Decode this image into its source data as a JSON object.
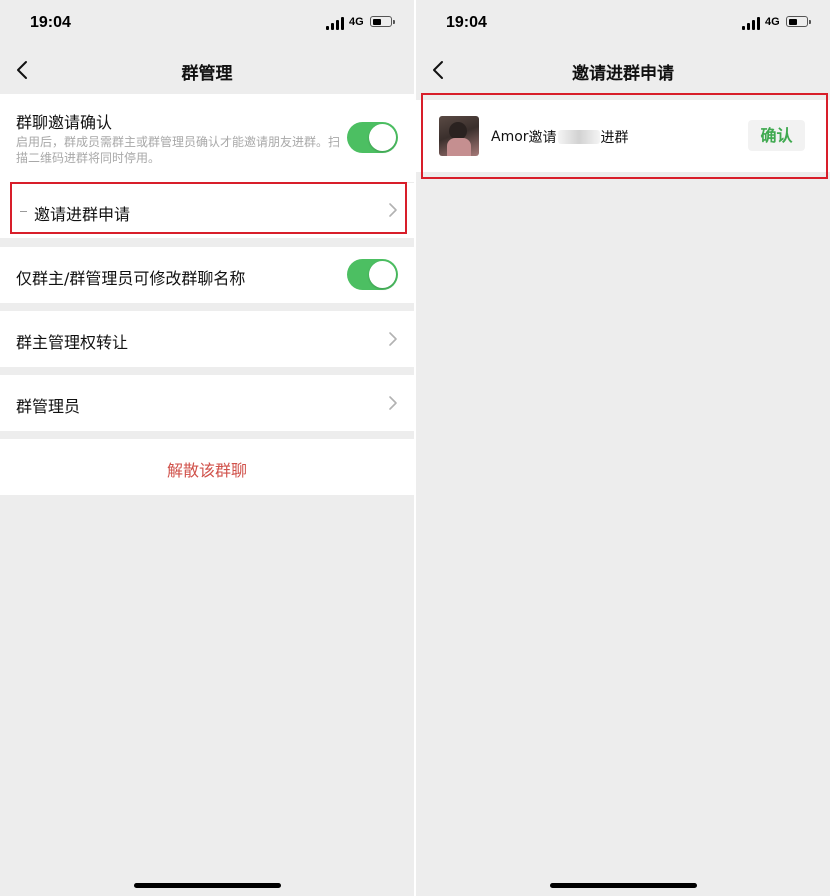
{
  "left_screen": {
    "status": {
      "time": "19:04",
      "network": "4G",
      "battery_level": 0.45
    },
    "nav": {
      "title": "群管理"
    },
    "invite_confirm": {
      "label": "群聊邀请确认",
      "description": "启用后，群成员需群主或群管理员确认才能邀请朋友进群。扫描二维码进群将同时停用。",
      "enabled": true
    },
    "invite_requests": {
      "label": "邀请进群申请"
    },
    "rename_restrict": {
      "label": "仅群主/群管理员可修改群聊名称",
      "enabled": true
    },
    "transfer_owner": {
      "label": "群主管理权转让"
    },
    "admins": {
      "label": "群管理员"
    },
    "dissolve": {
      "label": "解散该群聊"
    }
  },
  "right_screen": {
    "status": {
      "time": "19:04",
      "network": "4G",
      "battery_level": 0.45
    },
    "nav": {
      "title": "邀请进群申请"
    },
    "request": {
      "inviter": "Amor",
      "verb": "邀请",
      "suffix": "进群",
      "confirm_label": "确认"
    }
  },
  "colors": {
    "page_bg": "#ededed",
    "toggle_on": "#4cbf62",
    "highlight_box": "#d81e2a",
    "danger_text": "#d0514a",
    "confirm_text": "#3fa94f"
  },
  "icons": {
    "back": "back-chevron-icon",
    "disclosure": "chevron-right-icon",
    "signal": "cellular-signal-icon",
    "battery": "battery-icon"
  }
}
